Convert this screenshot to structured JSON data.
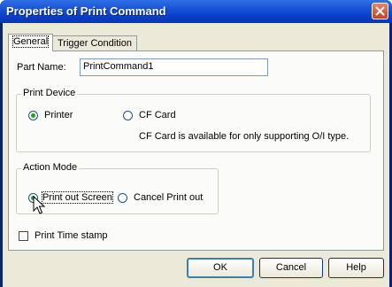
{
  "window": {
    "title": "Properties of Print Command"
  },
  "tabs": [
    {
      "label": "General",
      "active": true
    },
    {
      "label": "Trigger Condition",
      "active": false
    }
  ],
  "part_name": {
    "label": "Part Name:",
    "value": "PrintCommand1"
  },
  "print_device": {
    "title": "Print Device",
    "options": [
      {
        "label": "Printer",
        "selected": true
      },
      {
        "label": "CF Card",
        "selected": false
      }
    ],
    "note": "CF Card is available for only supporting O/I type."
  },
  "action_mode": {
    "title": "Action Mode",
    "options": [
      {
        "label": "Print out Screen",
        "selected": true
      },
      {
        "label": "Cancel Print out",
        "selected": false
      }
    ]
  },
  "time_stamp": {
    "label": "Print Time stamp",
    "checked": false
  },
  "buttons": {
    "ok": "OK",
    "cancel": "Cancel",
    "help": "Help"
  },
  "colors": {
    "titlebar": "#0a3fc9",
    "dialog_bg": "#ece9d8",
    "close_button": "#c9421f",
    "radio_selected": "#21a121"
  }
}
